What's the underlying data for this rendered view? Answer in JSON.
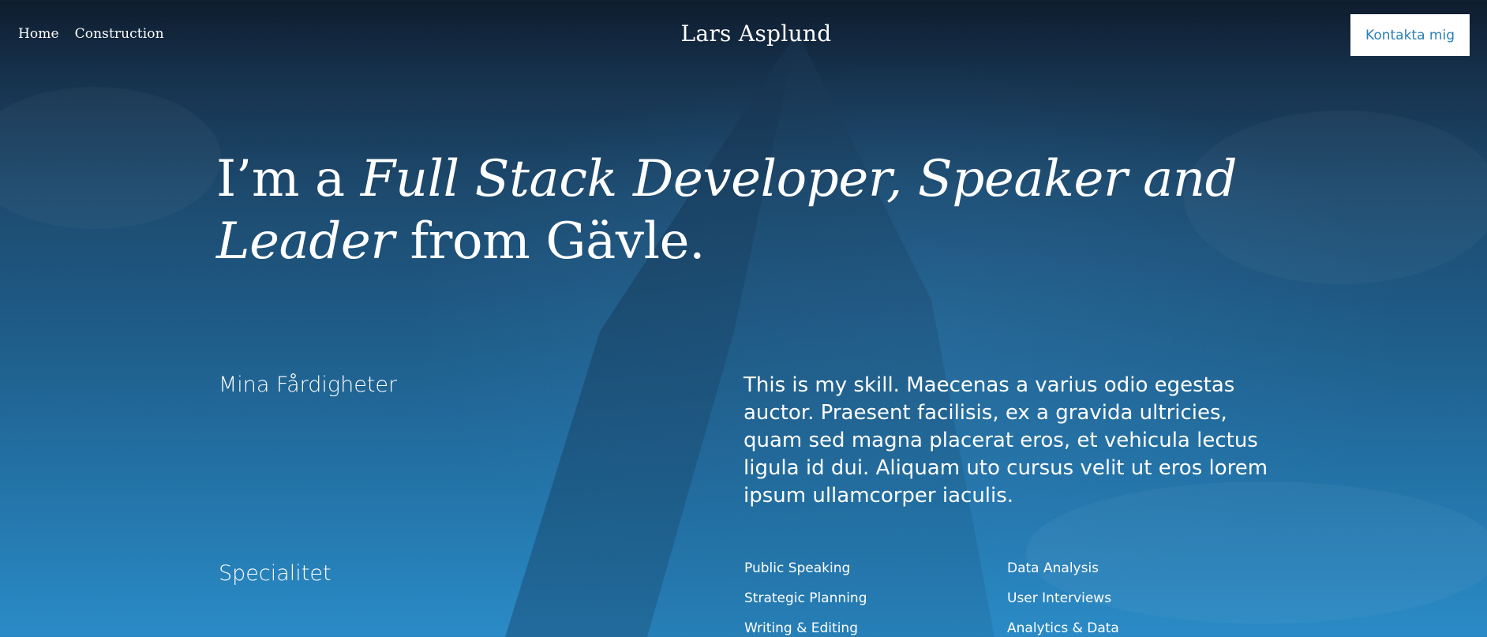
{
  "nav": {
    "items": [
      {
        "label": "Home"
      },
      {
        "label": "Construction"
      }
    ]
  },
  "site": {
    "title": "Lars Asplund",
    "contact_label": "Kontakta mig"
  },
  "hero": {
    "prefix": "I’m a ",
    "roles_line1": "Full Stack Developer, Speaker and",
    "roles_line2": "Leader",
    "suffix": " from Gävle."
  },
  "skills": {
    "label": "Mina Fårdigheter",
    "text": "This is my skill. Maecenas a varius odio egestas auctor. Praesent facilisis, ex a gravida ultricies, quam sed magna placerat eros, et vehicula lectus ligula id dui. Aliquam uto cursus velit ut eros lorem ipsum ullamcorper iaculis."
  },
  "specialty": {
    "label": "Specialitet",
    "column1": [
      "Public Speaking",
      "Strategic Planning",
      "Writing & Editing"
    ],
    "column2": [
      "Data Analysis",
      "User Interviews",
      "Analytics & Data"
    ]
  },
  "colors": {
    "accent": "#2b7fb8",
    "background_top": "#0f1c2e",
    "background_bottom": "#2b8bc6"
  }
}
